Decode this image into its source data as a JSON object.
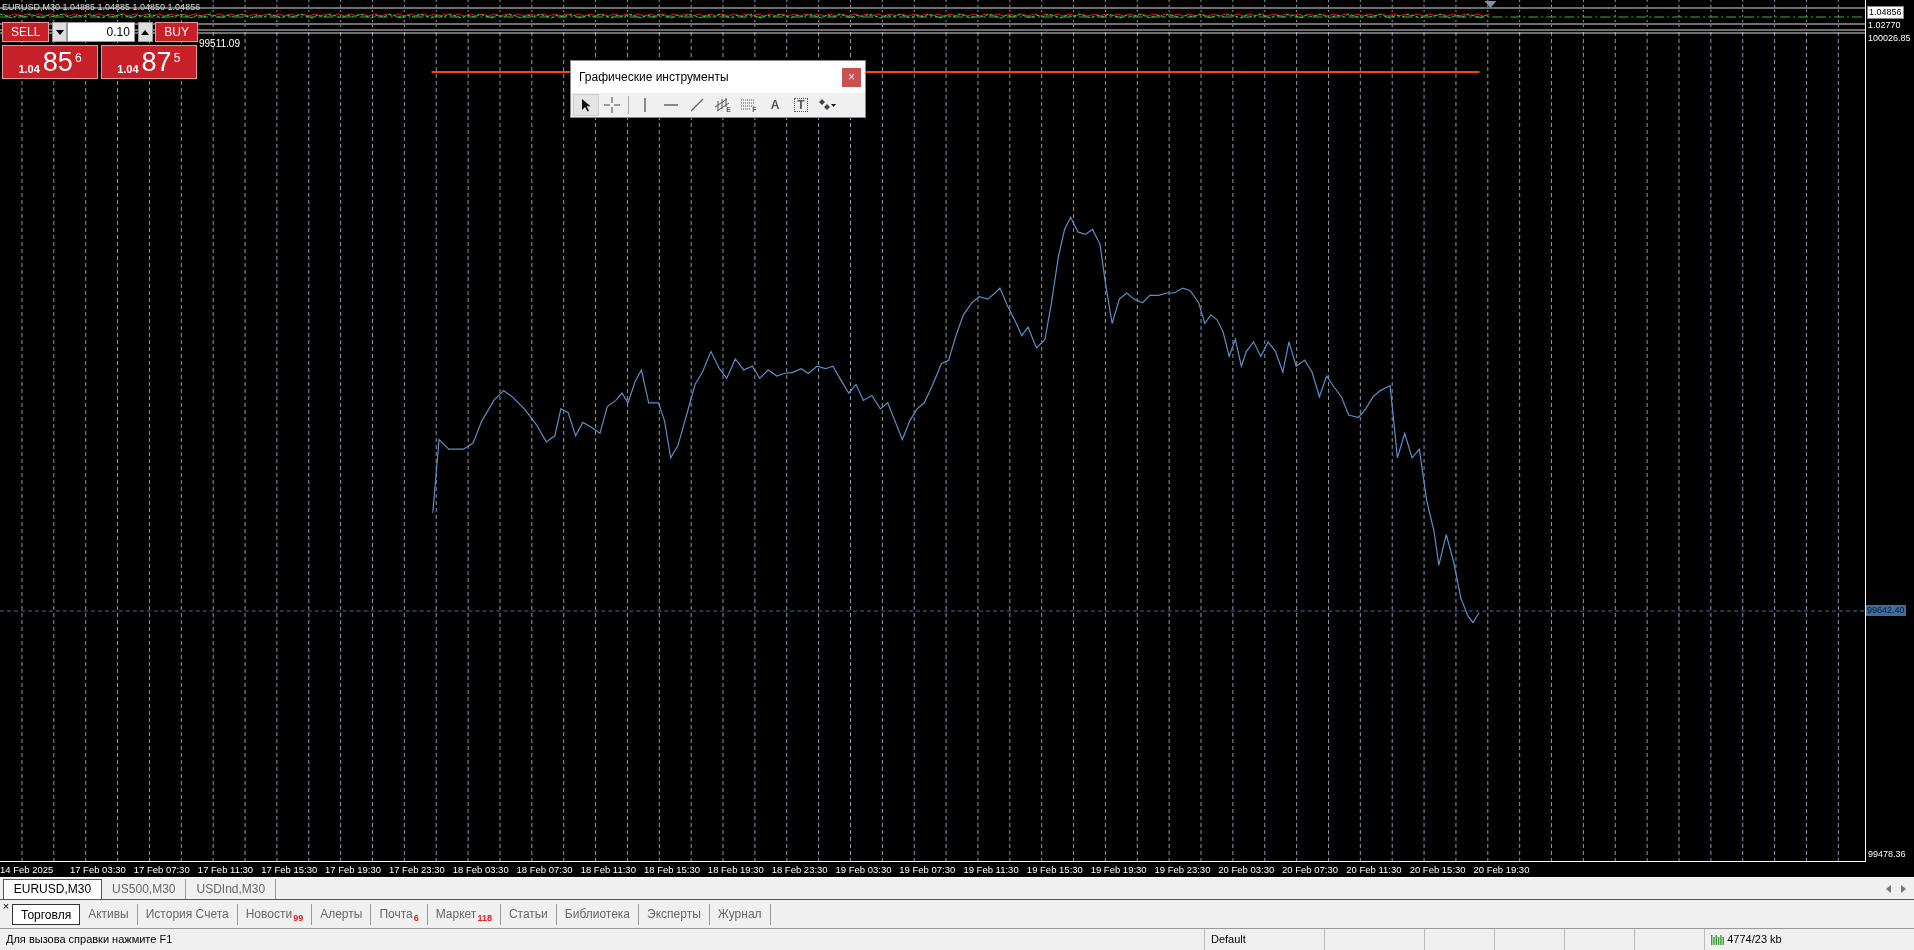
{
  "chart": {
    "header": "EURUSD,M30 1.04885 1.04885 1.04850 1.04856",
    "indicator_value": "99511.09",
    "trade_panel": {
      "sell_label": "SELL",
      "buy_label": "BUY",
      "lot": "0.10",
      "sell_price": {
        "prefix": "1.04",
        "big": "85",
        "sup": "6"
      },
      "buy_price": {
        "prefix": "1.04",
        "big": "87",
        "sup": "5"
      }
    },
    "price_scale": [
      {
        "text": "1.04856",
        "kind": "boxed"
      },
      {
        "text": "1.02770",
        "kind": "plain"
      },
      {
        "text": "100026.85",
        "kind": "plain"
      },
      {
        "text": "99642.40",
        "kind": "current"
      },
      {
        "text": "99478.36",
        "kind": "plain"
      }
    ],
    "time_axis": [
      "14 Feb 2025",
      "17 Feb 03:30",
      "17 Feb 07:30",
      "17 Feb 11:30",
      "17 Feb 15:30",
      "17 Feb 19:30",
      "17 Feb 23:30",
      "18 Feb 03:30",
      "18 Feb 07:30",
      "18 Feb 11:30",
      "18 Feb 15:30",
      "18 Feb 19:30",
      "18 Feb 23:30",
      "19 Feb 03:30",
      "19 Feb 07:30",
      "19 Feb 11:30",
      "19 Feb 15:30",
      "19 Feb 19:30",
      "19 Feb 23:30",
      "20 Feb 03:30",
      "20 Feb 07:30",
      "20 Feb 11:30",
      "20 Feb 15:30",
      "20 Feb 19:30"
    ]
  },
  "drawing_tools": {
    "title": "Графические инструменты",
    "close": "×",
    "tools": [
      {
        "kind": "cursor",
        "selected": true
      },
      {
        "kind": "crosshair",
        "selected": false
      },
      {
        "kind": "vline",
        "selected": false
      },
      {
        "kind": "hline",
        "selected": false
      },
      {
        "kind": "trendline",
        "selected": false
      },
      {
        "kind": "channel",
        "label": "E",
        "selected": false
      },
      {
        "kind": "fibo",
        "label": "F",
        "selected": false
      },
      {
        "kind": "text",
        "label": "A",
        "selected": false
      },
      {
        "kind": "textlabel",
        "label": "T",
        "selected": false
      },
      {
        "kind": "more",
        "selected": false
      }
    ]
  },
  "chart_tabs": [
    {
      "label": "EURUSD,M30",
      "selected": true
    },
    {
      "label": "US500,M30",
      "selected": false
    },
    {
      "label": "USDInd,M30",
      "selected": false
    }
  ],
  "terminal": {
    "close": "×",
    "tabs": [
      {
        "label": "Торговля",
        "selected": true
      },
      {
        "label": "Активы",
        "selected": false
      },
      {
        "label": "История Счета",
        "selected": false
      },
      {
        "label": "Новости",
        "count": "99",
        "selected": false
      },
      {
        "label": "Алерты",
        "selected": false
      },
      {
        "label": "Почта",
        "count": "6",
        "selected": false
      },
      {
        "label": "Маркет",
        "count": "118",
        "selected": false
      },
      {
        "label": "Статьи",
        "selected": false
      },
      {
        "label": "Библиотека",
        "selected": false
      },
      {
        "label": "Эксперты",
        "selected": false
      },
      {
        "label": "Журнал",
        "selected": false
      }
    ]
  },
  "status_bar": {
    "help": "Для вызова справки нажмите F1",
    "profile": "Default",
    "traffic": "4774/23 kb"
  }
}
